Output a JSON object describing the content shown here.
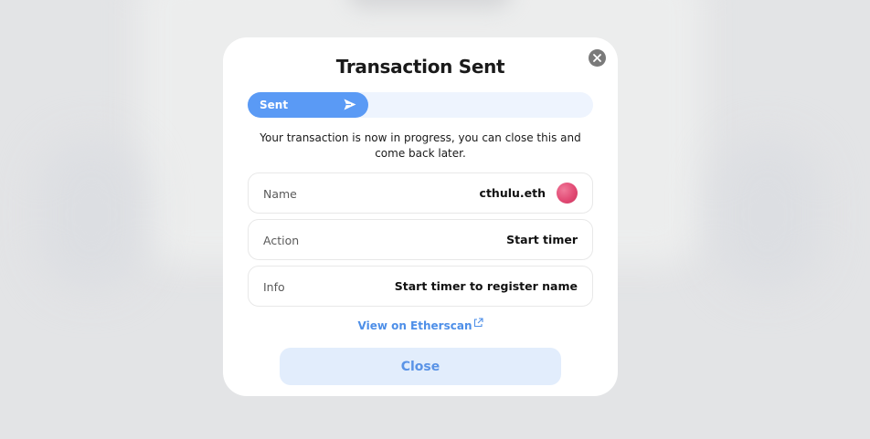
{
  "modal": {
    "title": "Transaction Sent",
    "description": "Your transaction is now in progress, you can close this and come back later.",
    "progress": {
      "label": "Sent",
      "fill_fraction": 0.35,
      "fill_color": "#5a9af5",
      "track_color": "#eef4fe"
    },
    "rows": [
      {
        "label": "Name",
        "value": "cthulu.eth",
        "has_avatar": true
      },
      {
        "label": "Action",
        "value": "Start timer",
        "has_avatar": false
      },
      {
        "label": "Info",
        "value": "Start timer to register name",
        "has_avatar": false
      }
    ],
    "link_text": "View on Etherscan",
    "close_button_label": "Close"
  },
  "icons": {
    "close": "close-circle-icon",
    "send": "send-arrow-icon",
    "external": "external-link-icon"
  },
  "colors": {
    "accent": "#5a9af5",
    "link": "#4e8fe8",
    "button_bg": "#e2edfc",
    "avatar": "#e24a74"
  }
}
